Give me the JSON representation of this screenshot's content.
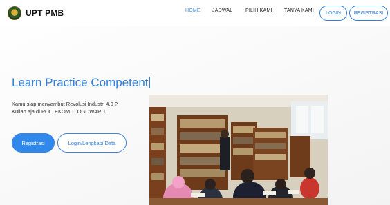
{
  "brand": {
    "name": "UPT PMB"
  },
  "nav": {
    "links": [
      "HOME",
      "JADWAL",
      "PILIH KAMI",
      "TANYA KAMI"
    ],
    "login_label": "LOGIN",
    "register_label": "REGISTRASI"
  },
  "hero": {
    "title": "Learn Practice Competent",
    "desc_line1": "Kamu siap menyambut Revolusi Industri 4.0 ?",
    "desc_line2": "Kuliah aja di POLTEKOM TLOGOWARU .",
    "primary_button": "Registrasi",
    "secondary_button": "Login/Lengkapi Data"
  },
  "colors": {
    "accent": "#2f7fde",
    "primary_button_bg": "#3088ea"
  }
}
